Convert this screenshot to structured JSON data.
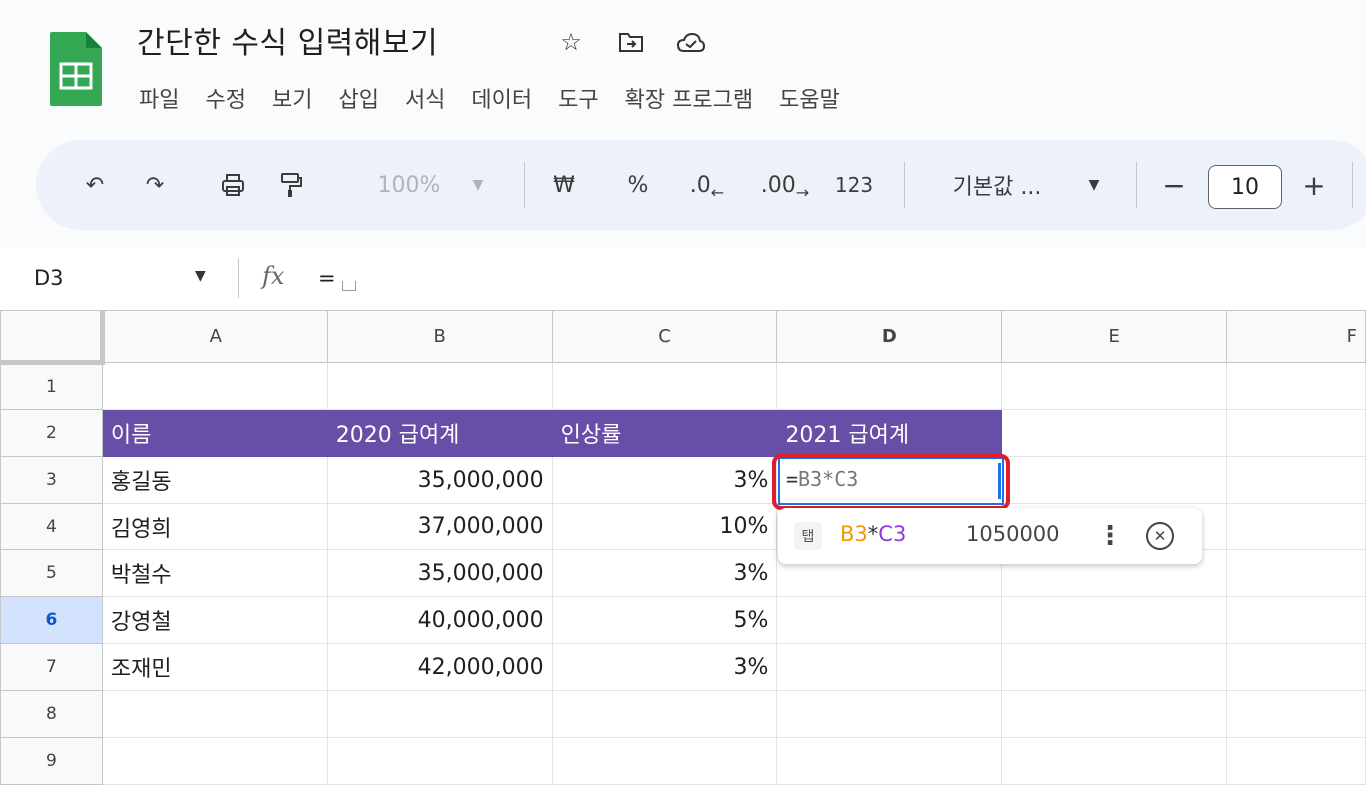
{
  "doc": {
    "title": "간단한 수식 입력해보기"
  },
  "icons": {
    "app": "sheets-icon",
    "star": "star-icon",
    "move": "folder-move-icon",
    "cloud": "cloud-status-icon"
  },
  "menu": [
    "파일",
    "수정",
    "보기",
    "삽입",
    "서식",
    "데이터",
    "도구",
    "확장 프로그램",
    "도움말"
  ],
  "toolbar": {
    "undo": "↶",
    "redo": "↷",
    "print": "⎙",
    "paint": "🖌",
    "zoom": "100%",
    "currency": "₩",
    "percent": "%",
    "dec_decrease": ".0",
    "dec_increase": ".00",
    "number_format": "123",
    "font": "기본값 ...",
    "minus": "−",
    "font_size": "10",
    "plus": "+"
  },
  "formula_bar": {
    "cell_ref": "D3",
    "fx": "fx",
    "content": "="
  },
  "grid": {
    "columns": [
      "A",
      "B",
      "C",
      "D",
      "E",
      "F"
    ],
    "rows": [
      {
        "num": "1",
        "cells": [
          "",
          "",
          "",
          "",
          "",
          ""
        ]
      },
      {
        "num": "2",
        "cells": [
          "이름",
          "2020 급여계",
          "인상률",
          "2021 급여계",
          "",
          ""
        ]
      },
      {
        "num": "3",
        "cells": [
          "홍길동",
          "35,000,000",
          "3%",
          "",
          "",
          ""
        ]
      },
      {
        "num": "4",
        "cells": [
          "김영희",
          "37,000,000",
          "10%",
          "",
          "",
          ""
        ]
      },
      {
        "num": "5",
        "cells": [
          "박철수",
          "35,000,000",
          "3%",
          "",
          "",
          ""
        ]
      },
      {
        "num": "6",
        "cells": [
          "강영철",
          "40,000,000",
          "5%",
          "",
          "",
          ""
        ]
      },
      {
        "num": "7",
        "cells": [
          "조재민",
          "42,000,000",
          "3%",
          "",
          "",
          ""
        ]
      },
      {
        "num": "8",
        "cells": [
          "",
          "",
          "",
          "",
          "",
          ""
        ]
      },
      {
        "num": "9",
        "cells": [
          "",
          "",
          "",
          "",
          "",
          ""
        ]
      }
    ]
  },
  "active_cell": {
    "op": "=",
    "ref1": "B3",
    "star": "*",
    "ref2": "C3"
  },
  "suggestion": {
    "tab": "탭",
    "ref1": "B3",
    "star": "*",
    "ref2": "C3",
    "result": "1050000",
    "more": "⋮",
    "close": "✕"
  },
  "colors": {
    "header_fill": "#674ea7",
    "selected": "#1a73e8",
    "highlight": "#e11d2b"
  }
}
